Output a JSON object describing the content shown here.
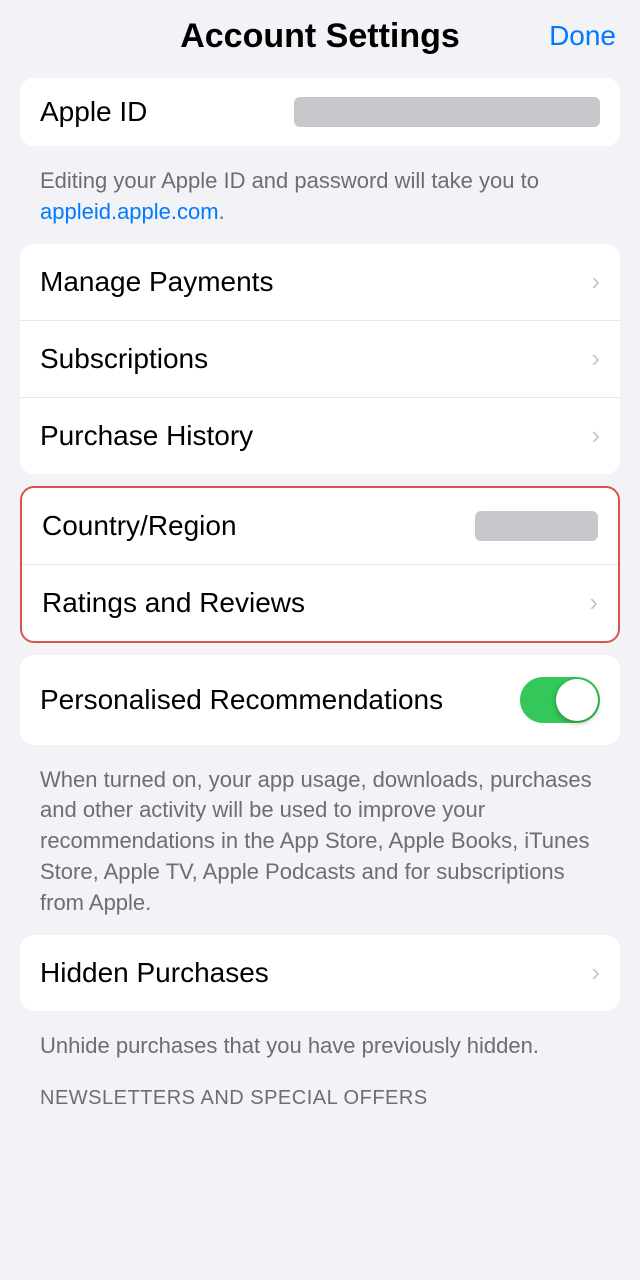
{
  "header": {
    "title": "Account Settings",
    "done_label": "Done"
  },
  "apple_id": {
    "label": "Apple ID",
    "value_placeholder": "●●●●●●●●●●●●●●●●●●●",
    "helper_text_prefix": "Editing your Apple ID and password will take you to ",
    "helper_link_text": "appleid.apple.com",
    "helper_text_suffix": "."
  },
  "menu_items": [
    {
      "label": "Manage Payments",
      "has_chevron": true
    },
    {
      "label": "Subscriptions",
      "has_chevron": true
    },
    {
      "label": "Purchase History",
      "has_chevron": true
    }
  ],
  "country_region": {
    "label": "Country/Region",
    "value_placeholder": "●●●●●●●"
  },
  "ratings_reviews": {
    "label": "Ratings and Reviews",
    "has_chevron": true
  },
  "personalised": {
    "label": "Personalised Recommendations",
    "is_on": true,
    "description": "When turned on, your app usage, downloads, purchases and other activity will be used to improve your recommendations in the App Store, Apple Books, iTunes Store, Apple TV, Apple Podcasts and for subscriptions from Apple."
  },
  "hidden_purchases": {
    "label": "Hidden Purchases",
    "description": "Unhide purchases that you have previously hidden.",
    "has_chevron": true
  },
  "section_label": "NEWSLETTERS AND SPECIAL OFFERS"
}
